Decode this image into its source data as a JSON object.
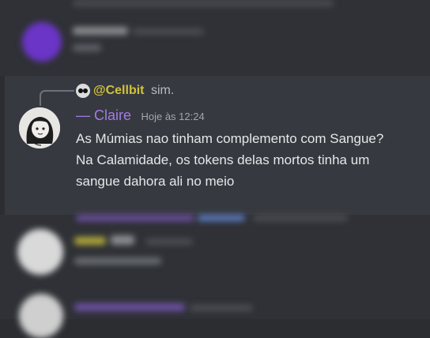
{
  "message": {
    "reply": {
      "mention": "@Cellbit",
      "text": "sim."
    },
    "author": "— Claire",
    "timestamp": "Hoje às 12:24",
    "content": "As Múmias nao tinham complemento com Sangue? Na Calamidade, os tokens delas mortos tinha um sangue dahora ali no meio"
  },
  "colors": {
    "background": "#2b2d31",
    "message_bg": "#36393f",
    "author_name": "#a47ae6",
    "mention": "#d4c23a",
    "content_text": "#e6e7e9",
    "timestamp": "#a3a6aa"
  }
}
